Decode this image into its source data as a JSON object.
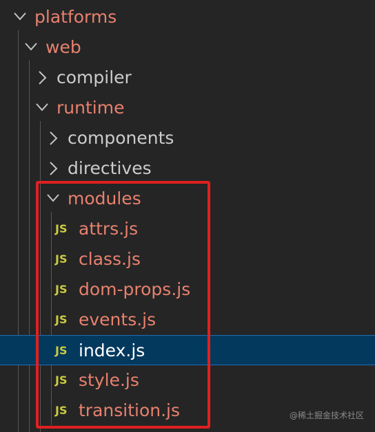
{
  "tree": {
    "platforms": "platforms",
    "web": "web",
    "compiler": "compiler",
    "runtime": "runtime",
    "components": "components",
    "directives": "directives",
    "modules": "modules",
    "files": [
      {
        "name": "attrs.js",
        "icon": "JS"
      },
      {
        "name": "class.js",
        "icon": "JS"
      },
      {
        "name": "dom-props.js",
        "icon": "JS"
      },
      {
        "name": "events.js",
        "icon": "JS"
      },
      {
        "name": "index.js",
        "icon": "JS",
        "selected": true
      },
      {
        "name": "style.js",
        "icon": "JS"
      },
      {
        "name": "transition.js",
        "icon": "JS"
      }
    ]
  },
  "watermark": "@稀土掘金技术社区",
  "colors": {
    "background": "#252526",
    "folder_open_text": "#e8816d",
    "folder_closed_text": "#cccccc",
    "js_icon": "#cbcb41",
    "selected_bg": "#04395e",
    "highlight_border": "#e02020"
  }
}
